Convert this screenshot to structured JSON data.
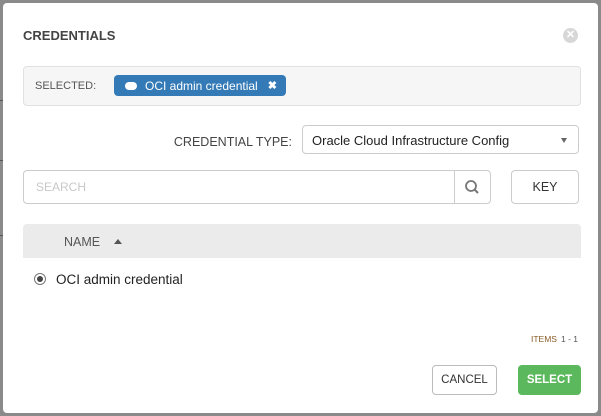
{
  "modal": {
    "title": "CREDENTIALS",
    "close_icon": "times-circle-icon",
    "selected_label": "SELECTED:",
    "selected_tag": {
      "icon": "cloud-icon",
      "label": "OCI admin credential",
      "remove": "✖"
    },
    "credential_type_label": "CREDENTIAL TYPE:",
    "credential_type_value": "Oracle Cloud Infrastructure Config",
    "search_placeholder": "SEARCH",
    "key_label": "KEY",
    "table": {
      "columns": [
        "NAME"
      ],
      "rows": [
        {
          "name": "OCI admin credential",
          "selected": true
        }
      ]
    },
    "items_label": "ITEMS",
    "items_range": "1 - 1",
    "cancel_label": "CANCEL",
    "select_label": "SELECT",
    "colors": {
      "tag": "#337ab7",
      "select_button": "#5cb85c"
    }
  }
}
